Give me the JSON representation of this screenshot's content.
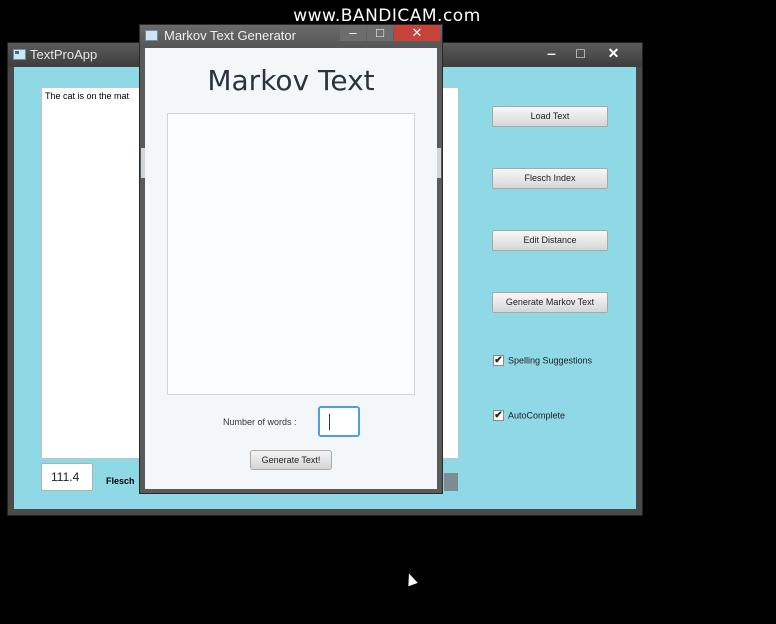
{
  "watermark": "www.BANDICAM.com",
  "main_window": {
    "title": "TextProApp",
    "controls": {
      "minimize": "‒",
      "maximize": "□",
      "close": "✕"
    },
    "text_area": {
      "value": "The cat is on the mat"
    },
    "buttons": {
      "load_text": "Load Text",
      "flesch_index": "Flesch Index",
      "edit_distance": "Edit Distance",
      "generate_markov": "Generate Markov Text"
    },
    "checkboxes": [
      {
        "label": "Spelling Suggestions",
        "checked": true,
        "mark": "✔"
      },
      {
        "label": "AutoComplete",
        "checked": true,
        "mark": "✔"
      }
    ],
    "flesch_score": "111.4",
    "flesch_label": "Flesch"
  },
  "dialog": {
    "title": "Markov Text Generator",
    "controls": {
      "minimize": "‒",
      "maximize": "□",
      "close": "✕"
    },
    "heading": "Markov Text",
    "output_value": "",
    "words_label": "Number of words :",
    "words_value": "",
    "generate_button": "Generate Text!"
  },
  "colors": {
    "client_bg": "#8fd8e6",
    "dialog_bg": "#f3f7f9",
    "focus_border": "#4da0e0"
  }
}
